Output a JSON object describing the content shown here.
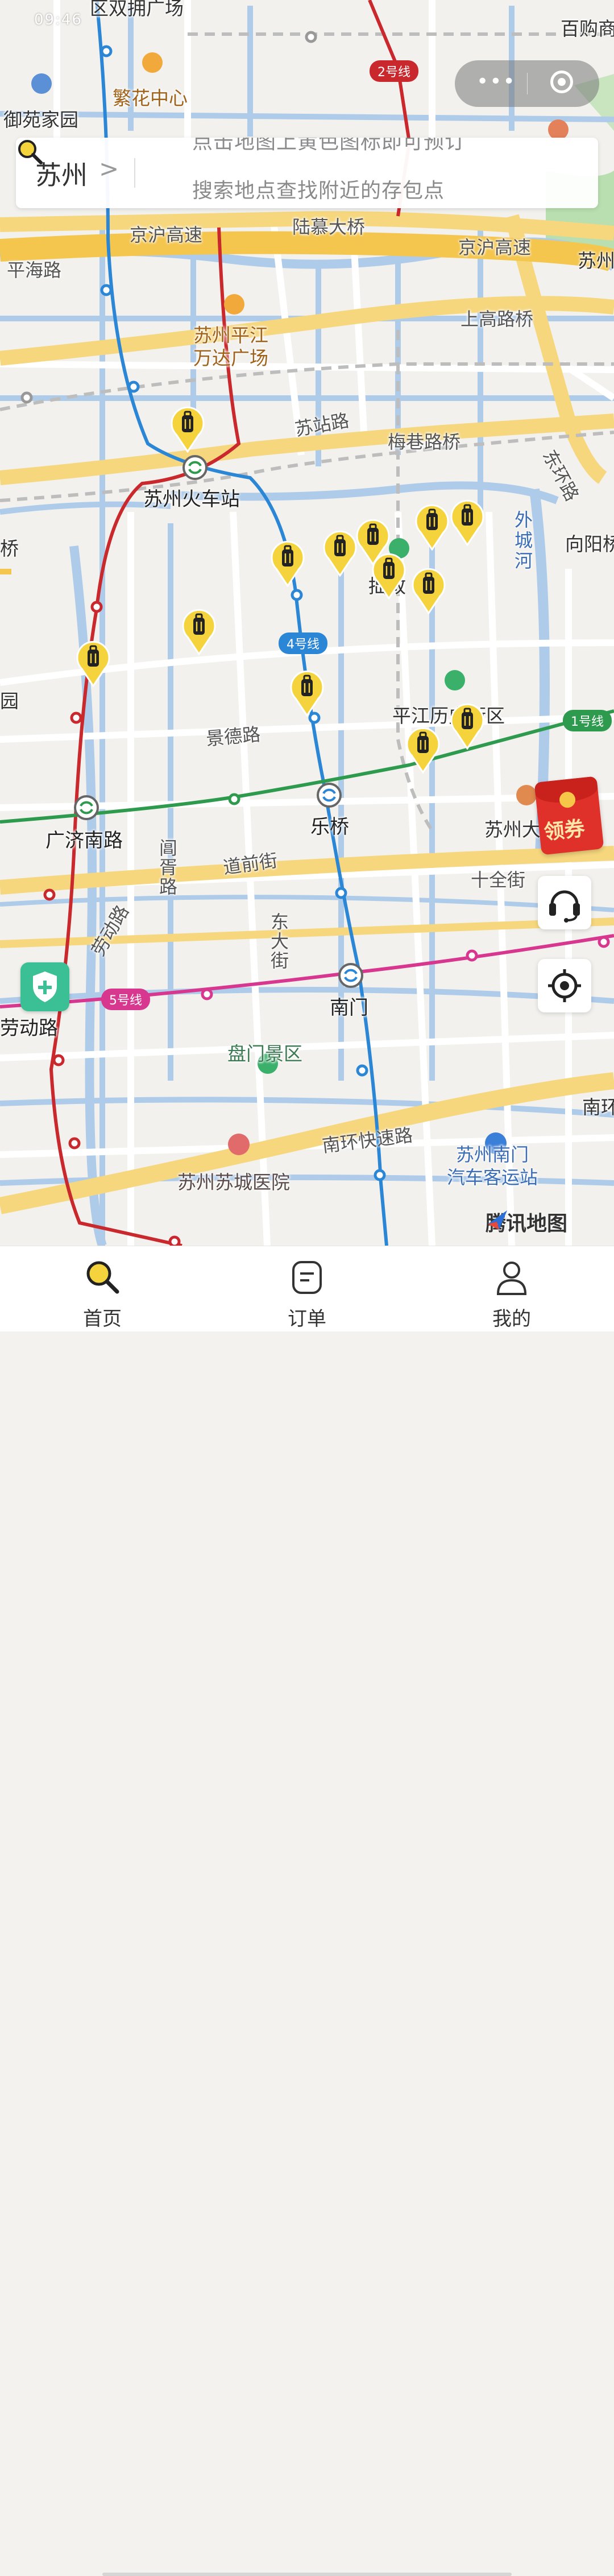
{
  "status_bar": {
    "time": "09:46"
  },
  "capsule": {
    "more_icon": "more-dots-icon",
    "close_icon": "target-icon"
  },
  "search": {
    "city": "苏州",
    "hint_line1": "点击地图上黄色图标即可预订",
    "hint_line2": "搜索地点查找附近的存包点"
  },
  "map": {
    "metro_badges": {
      "line2": "2号线",
      "line4": "4号线",
      "line1": "1号线",
      "line5": "5号线"
    },
    "labels": {
      "top_left_partial": "区双拥广场",
      "fanhua": "繁花中心",
      "yuyuan": "御苑家园",
      "top_right_partial": "百购商",
      "jinghu_left": "京沪高速",
      "lumu": "陆慕大桥",
      "jinghu_right": "京沪高速",
      "suzhou_right": "苏州",
      "pinghai": "平海路",
      "shanggao": "上高路桥",
      "wanda": "苏州平江\n万达广场",
      "suzhan": "苏站路",
      "meixiang": "梅巷路桥",
      "huochezhan": "苏州火车站",
      "dongjiu": "东环路",
      "waicheng": "外城河",
      "xiangyang": "向阳桥",
      "qiao_left": "桥",
      "yuan_left": "园",
      "zhuozheng_partial": "拙政",
      "pingjiang": "平江历史街区",
      "jingde": "景德路",
      "leqiao": "乐桥",
      "guangji": "广济南路",
      "changxu": "阊胥路",
      "daoqian": "道前街",
      "suzhoudaxue": "苏州大学",
      "shiquan": "十全街",
      "laodong_mid": "劳动路",
      "laodong": "劳动路",
      "dongda": "东大街",
      "nanmen": "南门",
      "panmen": "盘门景区",
      "nanhuan": "南环快速路",
      "nanhuan_right": "南环",
      "hospital": "苏州苏城医院",
      "bus_station": "苏州南门\n汽车客运站"
    },
    "locker_pin_count": 13
  },
  "floating": {
    "coupon": "领券",
    "support_icon": "headset-icon",
    "locate_icon": "locate-icon",
    "safety_icon": "shield-plus-icon"
  },
  "branding": {
    "map_provider": "腾讯地图"
  },
  "tabbar": {
    "items": [
      {
        "label": "首页",
        "icon": "search-icon"
      },
      {
        "label": "订单",
        "icon": "order-icon"
      },
      {
        "label": "我的",
        "icon": "user-icon"
      }
    ]
  },
  "colors": {
    "accent": "#f4d33c",
    "line1": "#2e9a4e",
    "line2": "#c9282d",
    "line4": "#2b86d6",
    "line5": "#d8378f"
  }
}
